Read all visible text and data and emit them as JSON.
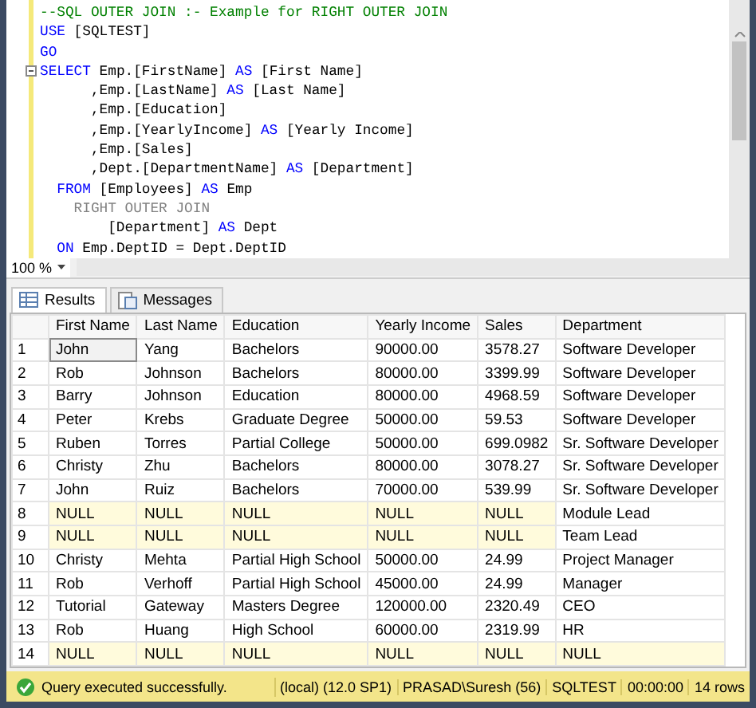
{
  "editor": {
    "lines": [
      {
        "fold": false,
        "tokens": [
          {
            "kind": "comment",
            "text": "--SQL OUTER JOIN :- Example for RIGHT OUTER JOIN"
          }
        ]
      },
      {
        "fold": false,
        "tokens": [
          {
            "kind": "keyword",
            "text": "USE"
          },
          {
            "kind": "plain",
            "text": " [SQLTEST]"
          }
        ]
      },
      {
        "fold": false,
        "tokens": [
          {
            "kind": "keyword",
            "text": "GO"
          }
        ]
      },
      {
        "fold": true,
        "tokens": [
          {
            "kind": "keyword",
            "text": "SELECT"
          },
          {
            "kind": "plain",
            "text": " Emp.[FirstName] "
          },
          {
            "kind": "keyword",
            "text": "AS"
          },
          {
            "kind": "plain",
            "text": " [First Name]"
          }
        ]
      },
      {
        "fold": false,
        "tokens": [
          {
            "kind": "plain",
            "text": "      ,Emp.[LastName] "
          },
          {
            "kind": "keyword",
            "text": "AS"
          },
          {
            "kind": "plain",
            "text": " [Last Name]"
          }
        ]
      },
      {
        "fold": false,
        "tokens": [
          {
            "kind": "plain",
            "text": "      ,Emp.[Education]"
          }
        ]
      },
      {
        "fold": false,
        "tokens": [
          {
            "kind": "plain",
            "text": "      ,Emp.[YearlyIncome] "
          },
          {
            "kind": "keyword",
            "text": "AS"
          },
          {
            "kind": "plain",
            "text": " [Yearly Income]"
          }
        ]
      },
      {
        "fold": false,
        "tokens": [
          {
            "kind": "plain",
            "text": "      ,Emp.[Sales]"
          }
        ]
      },
      {
        "fold": false,
        "tokens": [
          {
            "kind": "plain",
            "text": "      ,Dept.[DepartmentName] "
          },
          {
            "kind": "keyword",
            "text": "AS"
          },
          {
            "kind": "plain",
            "text": " [Department]"
          }
        ]
      },
      {
        "fold": false,
        "tokens": [
          {
            "kind": "keyword",
            "text": "  FROM"
          },
          {
            "kind": "plain",
            "text": " [Employees] "
          },
          {
            "kind": "keyword",
            "text": "AS"
          },
          {
            "kind": "plain",
            "text": " Emp"
          }
        ]
      },
      {
        "fold": false,
        "tokens": [
          {
            "kind": "operator",
            "text": "    RIGHT OUTER JOIN"
          }
        ]
      },
      {
        "fold": false,
        "tokens": [
          {
            "kind": "plain",
            "text": "        [Department] "
          },
          {
            "kind": "keyword",
            "text": "AS"
          },
          {
            "kind": "plain",
            "text": " Dept"
          }
        ]
      },
      {
        "fold": false,
        "tokens": [
          {
            "kind": "keyword",
            "text": "  ON"
          },
          {
            "kind": "plain",
            "text": " Emp.DeptID = Dept.DeptID"
          }
        ]
      }
    ],
    "zoom": "100 %"
  },
  "tabs": [
    {
      "label": "Results",
      "selected": true
    },
    {
      "label": "Messages",
      "selected": false
    }
  ],
  "table": {
    "columns": [
      "First Name",
      "Last Name",
      "Education",
      "Yearly Income",
      "Sales",
      "Department"
    ],
    "rows": [
      {
        "number": "1",
        "cells": [
          {
            "text": "John",
            "selected": true,
            "null": false
          },
          {
            "text": "Yang",
            "selected": false,
            "null": false
          },
          {
            "text": "Bachelors",
            "selected": false,
            "null": false
          },
          {
            "text": "90000.00",
            "selected": false,
            "null": false
          },
          {
            "text": "3578.27",
            "selected": false,
            "null": false
          },
          {
            "text": "Software Developer",
            "selected": false,
            "null": false
          }
        ]
      },
      {
        "number": "2",
        "cells": [
          {
            "text": "Rob",
            "selected": false,
            "null": false
          },
          {
            "text": "Johnson",
            "selected": false,
            "null": false
          },
          {
            "text": "Bachelors",
            "selected": false,
            "null": false
          },
          {
            "text": "80000.00",
            "selected": false,
            "null": false
          },
          {
            "text": "3399.99",
            "selected": false,
            "null": false
          },
          {
            "text": "Software Developer",
            "selected": false,
            "null": false
          }
        ]
      },
      {
        "number": "3",
        "cells": [
          {
            "text": "Barry",
            "selected": false,
            "null": false
          },
          {
            "text": "Johnson",
            "selected": false,
            "null": false
          },
          {
            "text": "Education",
            "selected": false,
            "null": false
          },
          {
            "text": "80000.00",
            "selected": false,
            "null": false
          },
          {
            "text": "4968.59",
            "selected": false,
            "null": false
          },
          {
            "text": "Software Developer",
            "selected": false,
            "null": false
          }
        ]
      },
      {
        "number": "4",
        "cells": [
          {
            "text": "Peter",
            "selected": false,
            "null": false
          },
          {
            "text": "Krebs",
            "selected": false,
            "null": false
          },
          {
            "text": "Graduate Degree",
            "selected": false,
            "null": false
          },
          {
            "text": "50000.00",
            "selected": false,
            "null": false
          },
          {
            "text": "59.53",
            "selected": false,
            "null": false
          },
          {
            "text": "Software Developer",
            "selected": false,
            "null": false
          }
        ]
      },
      {
        "number": "5",
        "cells": [
          {
            "text": "Ruben",
            "selected": false,
            "null": false
          },
          {
            "text": "Torres",
            "selected": false,
            "null": false
          },
          {
            "text": "Partial College",
            "selected": false,
            "null": false
          },
          {
            "text": "50000.00",
            "selected": false,
            "null": false
          },
          {
            "text": "699.0982",
            "selected": false,
            "null": false
          },
          {
            "text": "Sr. Software Developer",
            "selected": false,
            "null": false
          }
        ]
      },
      {
        "number": "6",
        "cells": [
          {
            "text": "Christy",
            "selected": false,
            "null": false
          },
          {
            "text": "Zhu",
            "selected": false,
            "null": false
          },
          {
            "text": "Bachelors",
            "selected": false,
            "null": false
          },
          {
            "text": "80000.00",
            "selected": false,
            "null": false
          },
          {
            "text": "3078.27",
            "selected": false,
            "null": false
          },
          {
            "text": "Sr. Software Developer",
            "selected": false,
            "null": false
          }
        ]
      },
      {
        "number": "7",
        "cells": [
          {
            "text": "John",
            "selected": false,
            "null": false
          },
          {
            "text": "Ruiz",
            "selected": false,
            "null": false
          },
          {
            "text": "Bachelors",
            "selected": false,
            "null": false
          },
          {
            "text": "70000.00",
            "selected": false,
            "null": false
          },
          {
            "text": "539.99",
            "selected": false,
            "null": false
          },
          {
            "text": "Sr. Software Developer",
            "selected": false,
            "null": false
          }
        ]
      },
      {
        "number": "8",
        "cells": [
          {
            "text": "NULL",
            "selected": false,
            "null": true
          },
          {
            "text": "NULL",
            "selected": false,
            "null": true
          },
          {
            "text": "NULL",
            "selected": false,
            "null": true
          },
          {
            "text": "NULL",
            "selected": false,
            "null": true
          },
          {
            "text": "NULL",
            "selected": false,
            "null": true
          },
          {
            "text": "Module Lead",
            "selected": false,
            "null": false
          }
        ]
      },
      {
        "number": "9",
        "cells": [
          {
            "text": "NULL",
            "selected": false,
            "null": true
          },
          {
            "text": "NULL",
            "selected": false,
            "null": true
          },
          {
            "text": "NULL",
            "selected": false,
            "null": true
          },
          {
            "text": "NULL",
            "selected": false,
            "null": true
          },
          {
            "text": "NULL",
            "selected": false,
            "null": true
          },
          {
            "text": "Team Lead",
            "selected": false,
            "null": false
          }
        ]
      },
      {
        "number": "10",
        "cells": [
          {
            "text": "Christy",
            "selected": false,
            "null": false
          },
          {
            "text": "Mehta",
            "selected": false,
            "null": false
          },
          {
            "text": "Partial High School",
            "selected": false,
            "null": false
          },
          {
            "text": "50000.00",
            "selected": false,
            "null": false
          },
          {
            "text": "24.99",
            "selected": false,
            "null": false
          },
          {
            "text": "Project Manager",
            "selected": false,
            "null": false
          }
        ]
      },
      {
        "number": "11",
        "cells": [
          {
            "text": "Rob",
            "selected": false,
            "null": false
          },
          {
            "text": "Verhoff",
            "selected": false,
            "null": false
          },
          {
            "text": "Partial High School",
            "selected": false,
            "null": false
          },
          {
            "text": "45000.00",
            "selected": false,
            "null": false
          },
          {
            "text": "24.99",
            "selected": false,
            "null": false
          },
          {
            "text": "Manager",
            "selected": false,
            "null": false
          }
        ]
      },
      {
        "number": "12",
        "cells": [
          {
            "text": "Tutorial",
            "selected": false,
            "null": false
          },
          {
            "text": "Gateway",
            "selected": false,
            "null": false
          },
          {
            "text": "Masters Degree",
            "selected": false,
            "null": false
          },
          {
            "text": "120000.00",
            "selected": false,
            "null": false
          },
          {
            "text": "2320.49",
            "selected": false,
            "null": false
          },
          {
            "text": "CEO",
            "selected": false,
            "null": false
          }
        ]
      },
      {
        "number": "13",
        "cells": [
          {
            "text": "Rob",
            "selected": false,
            "null": false
          },
          {
            "text": "Huang",
            "selected": false,
            "null": false
          },
          {
            "text": "High School",
            "selected": false,
            "null": false
          },
          {
            "text": "60000.00",
            "selected": false,
            "null": false
          },
          {
            "text": "2319.99",
            "selected": false,
            "null": false
          },
          {
            "text": "HR",
            "selected": false,
            "null": false
          }
        ]
      },
      {
        "number": "14",
        "cells": [
          {
            "text": "NULL",
            "selected": false,
            "null": true
          },
          {
            "text": "NULL",
            "selected": false,
            "null": true
          },
          {
            "text": "NULL",
            "selected": false,
            "null": true
          },
          {
            "text": "NULL",
            "selected": false,
            "null": true
          },
          {
            "text": "NULL",
            "selected": false,
            "null": true
          },
          {
            "text": "NULL",
            "selected": false,
            "null": true
          }
        ]
      }
    ]
  },
  "status_bar": {
    "message": "Query executed successfully.",
    "server": "(local) (12.0 SP1)",
    "user": "PRASAD\\Suresh (56)",
    "database": "SQLTEST",
    "elapsed": "00:00:00",
    "rows": "14 rows"
  }
}
